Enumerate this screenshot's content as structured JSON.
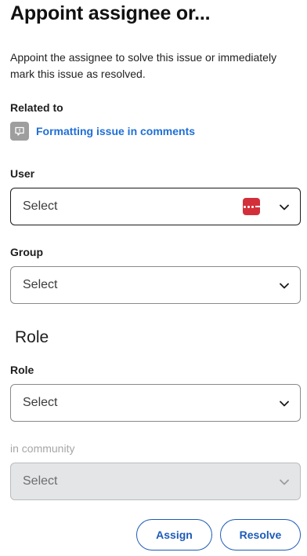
{
  "dialog": {
    "title": "Appoint assignee or...",
    "description": "Appoint the assignee to solve this issue or immediately mark this issue as resolved."
  },
  "related": {
    "label": "Related to",
    "icon": "comment-issue-icon",
    "link_text": "Formatting issue in comments"
  },
  "user_field": {
    "label": "User",
    "value": "Select",
    "extension_icon": "password-manager-icon",
    "badge_color": "#d32f3a"
  },
  "group_field": {
    "label": "Group",
    "value": "Select"
  },
  "role_section": {
    "heading": "Role",
    "role_field": {
      "label": "Role",
      "value": "Select"
    },
    "community_field": {
      "label": "in community",
      "value": "Select",
      "disabled": true
    }
  },
  "actions": {
    "assign_label": "Assign",
    "resolve_label": "Resolve",
    "accent_color": "#1d5bb8"
  }
}
